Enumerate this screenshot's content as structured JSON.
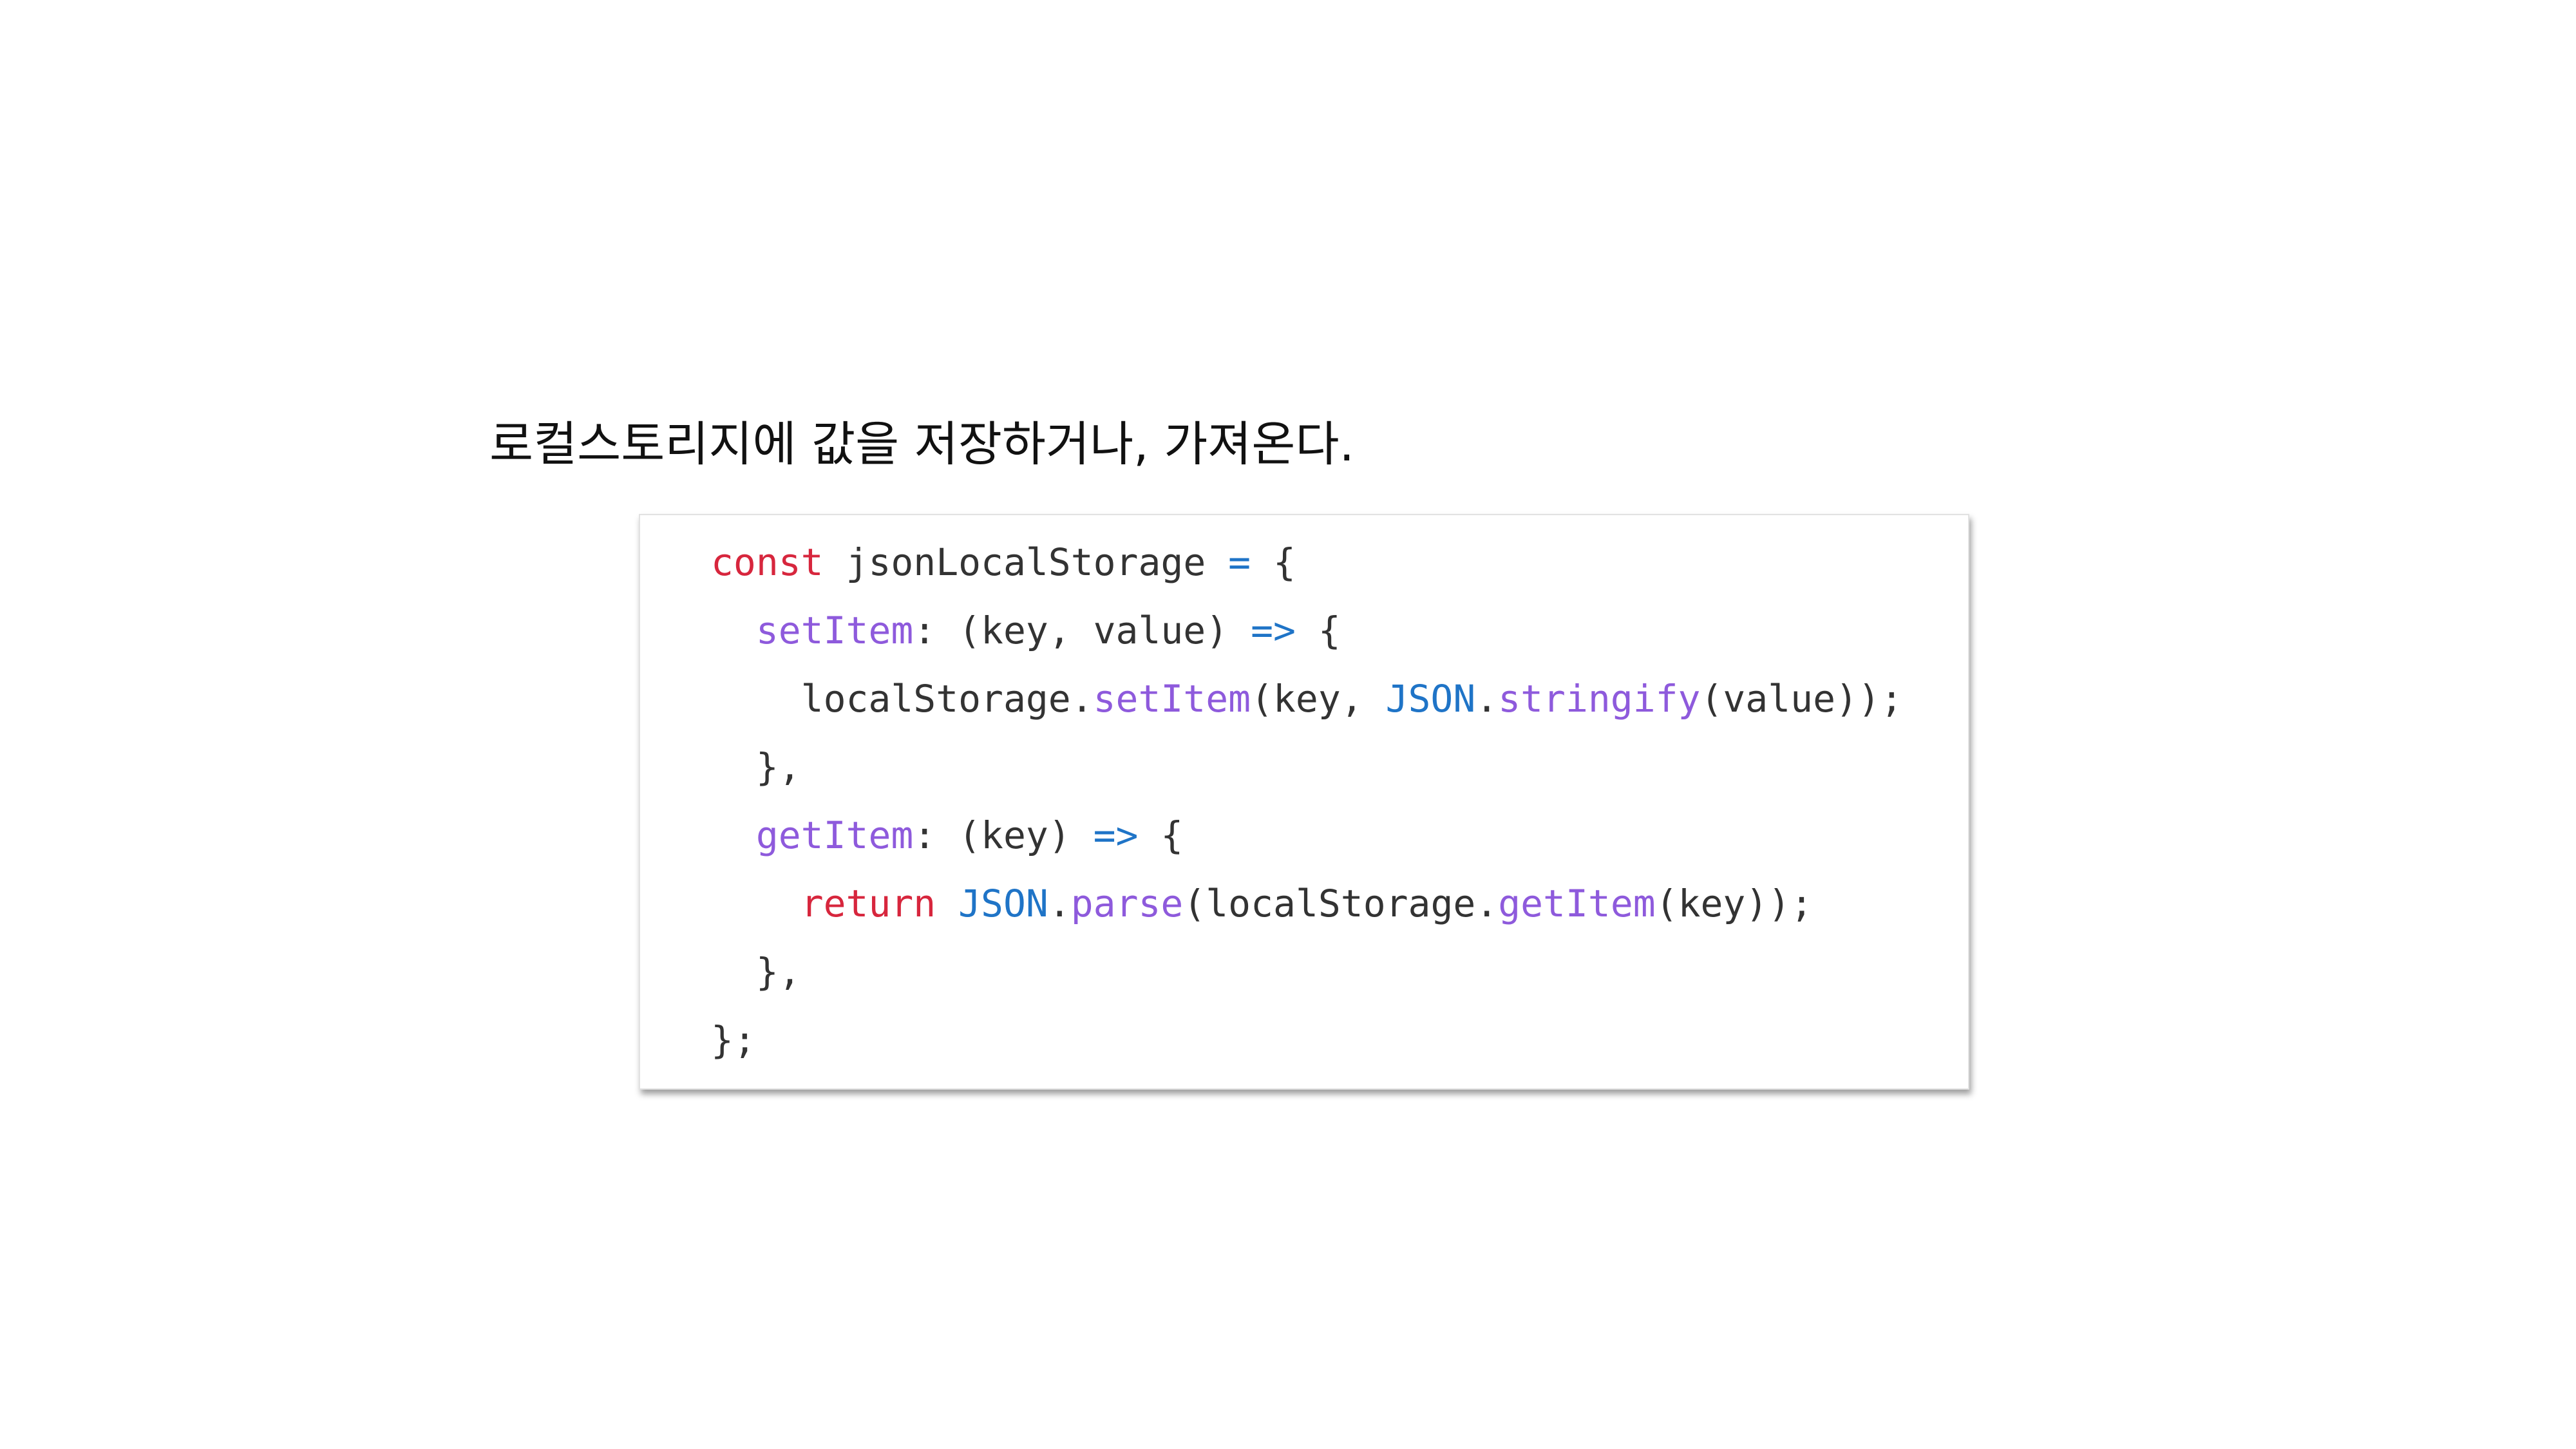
{
  "heading": "로컬스토리지에 값을 저장하거나, 가져온다.",
  "colors": {
    "keyword": "#d7263d",
    "property": "#8e5adc",
    "operator": "#1f74c7",
    "builtin": "#1f74c7",
    "plain": "#333333"
  },
  "code": {
    "lines": [
      [
        {
          "t": "const",
          "c": "keyword"
        },
        {
          "t": " jsonLocalStorage ",
          "c": "plain"
        },
        {
          "t": "=",
          "c": "operator"
        },
        {
          "t": " {",
          "c": "plain"
        }
      ],
      [
        {
          "t": "  ",
          "c": "plain"
        },
        {
          "t": "setItem",
          "c": "property"
        },
        {
          "t": ": (key, value) ",
          "c": "plain"
        },
        {
          "t": "=>",
          "c": "operator"
        },
        {
          "t": " {",
          "c": "plain"
        }
      ],
      [
        {
          "t": "    localStorage.",
          "c": "plain"
        },
        {
          "t": "setItem",
          "c": "property"
        },
        {
          "t": "(key, ",
          "c": "plain"
        },
        {
          "t": "JSON",
          "c": "builtin"
        },
        {
          "t": ".",
          "c": "plain"
        },
        {
          "t": "stringify",
          "c": "property"
        },
        {
          "t": "(value));",
          "c": "plain"
        }
      ],
      [
        {
          "t": "  },",
          "c": "plain"
        }
      ],
      [
        {
          "t": "  ",
          "c": "plain"
        },
        {
          "t": "getItem",
          "c": "property"
        },
        {
          "t": ": (key) ",
          "c": "plain"
        },
        {
          "t": "=>",
          "c": "operator"
        },
        {
          "t": " {",
          "c": "plain"
        }
      ],
      [
        {
          "t": "    ",
          "c": "plain"
        },
        {
          "t": "return",
          "c": "keyword"
        },
        {
          "t": " ",
          "c": "plain"
        },
        {
          "t": "JSON",
          "c": "builtin"
        },
        {
          "t": ".",
          "c": "plain"
        },
        {
          "t": "parse",
          "c": "property"
        },
        {
          "t": "(localStorage.",
          "c": "plain"
        },
        {
          "t": "getItem",
          "c": "property"
        },
        {
          "t": "(key));",
          "c": "plain"
        }
      ],
      [
        {
          "t": "  },",
          "c": "plain"
        }
      ],
      [
        {
          "t": "};",
          "c": "plain"
        }
      ]
    ]
  }
}
